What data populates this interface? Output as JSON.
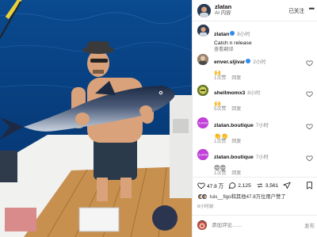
{
  "post": {
    "username": "zlatan",
    "subtitle": "AI 内容",
    "follow_label": "已关注",
    "more_label": "•••",
    "caption": {
      "username": "zlatan",
      "time": "8小时",
      "text": "Catch n release",
      "translate": "查看翻译"
    }
  },
  "comments": [
    {
      "user": "enver.sljivar",
      "verified": true,
      "time": "2小时",
      "text": "🙌",
      "likes": "1次赞",
      "reply": "回复"
    },
    {
      "user": "shellmomx3",
      "verified": false,
      "time": "8小时",
      "text": "🙌",
      "likes": "5次赞",
      "reply": "回复"
    },
    {
      "user": "zlatan.boutique",
      "verified": false,
      "time": "7小时",
      "text": "👏👏",
      "likes": "1次赞",
      "reply": "回复"
    },
    {
      "user": "zlatan.boutique",
      "verified": false,
      "time": "7小时",
      "text": "😍😍",
      "likes": "1次赞",
      "reply": "回复"
    }
  ],
  "actions": {
    "likes": "47.8 万",
    "comments": "2,125",
    "shares": "3,561"
  },
  "liked_by": {
    "text": "luis__figo和其他47.8万位用户赞了"
  },
  "posted_ago": "8小时前",
  "composer": {
    "placeholder": "添加评论……",
    "post_label": "发布"
  },
  "colors": {
    "verified": "#2d8cf0",
    "boutique_avatar": "#c040d8",
    "sea": "#0b3d7a",
    "deck": "#c8904f"
  }
}
